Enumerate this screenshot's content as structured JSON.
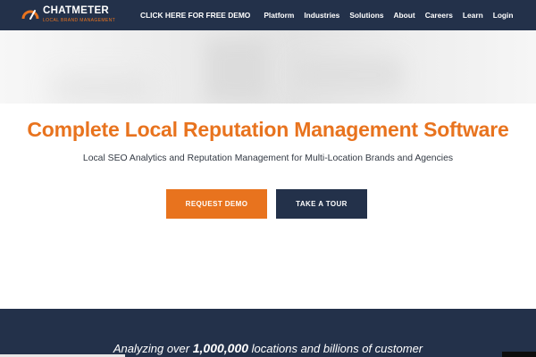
{
  "brand": {
    "name": "CHATMETER",
    "tagline": "LOCAL BRAND MANAGEMENT",
    "accent_color": "#e8731e",
    "navy_color": "#23314a"
  },
  "nav": {
    "items": [
      {
        "label": "CLICK HERE FOR FREE DEMO"
      },
      {
        "label": "Platform"
      },
      {
        "label": "Industries"
      },
      {
        "label": "Solutions"
      },
      {
        "label": "About"
      },
      {
        "label": "Careers"
      },
      {
        "label": "Learn"
      },
      {
        "label": "Login"
      }
    ]
  },
  "main": {
    "headline": "Complete Local Reputation Management Software",
    "subheadline": "Local SEO Analytics and Reputation Management for Multi-Location Brands and Agencies",
    "buttons": {
      "request_demo": "REQUEST DEMO",
      "take_tour": "TAKE A TOUR"
    }
  },
  "band": {
    "prefix": "Analyzing over ",
    "count": "1,000,000",
    "suffix": " locations and billions of customer"
  }
}
